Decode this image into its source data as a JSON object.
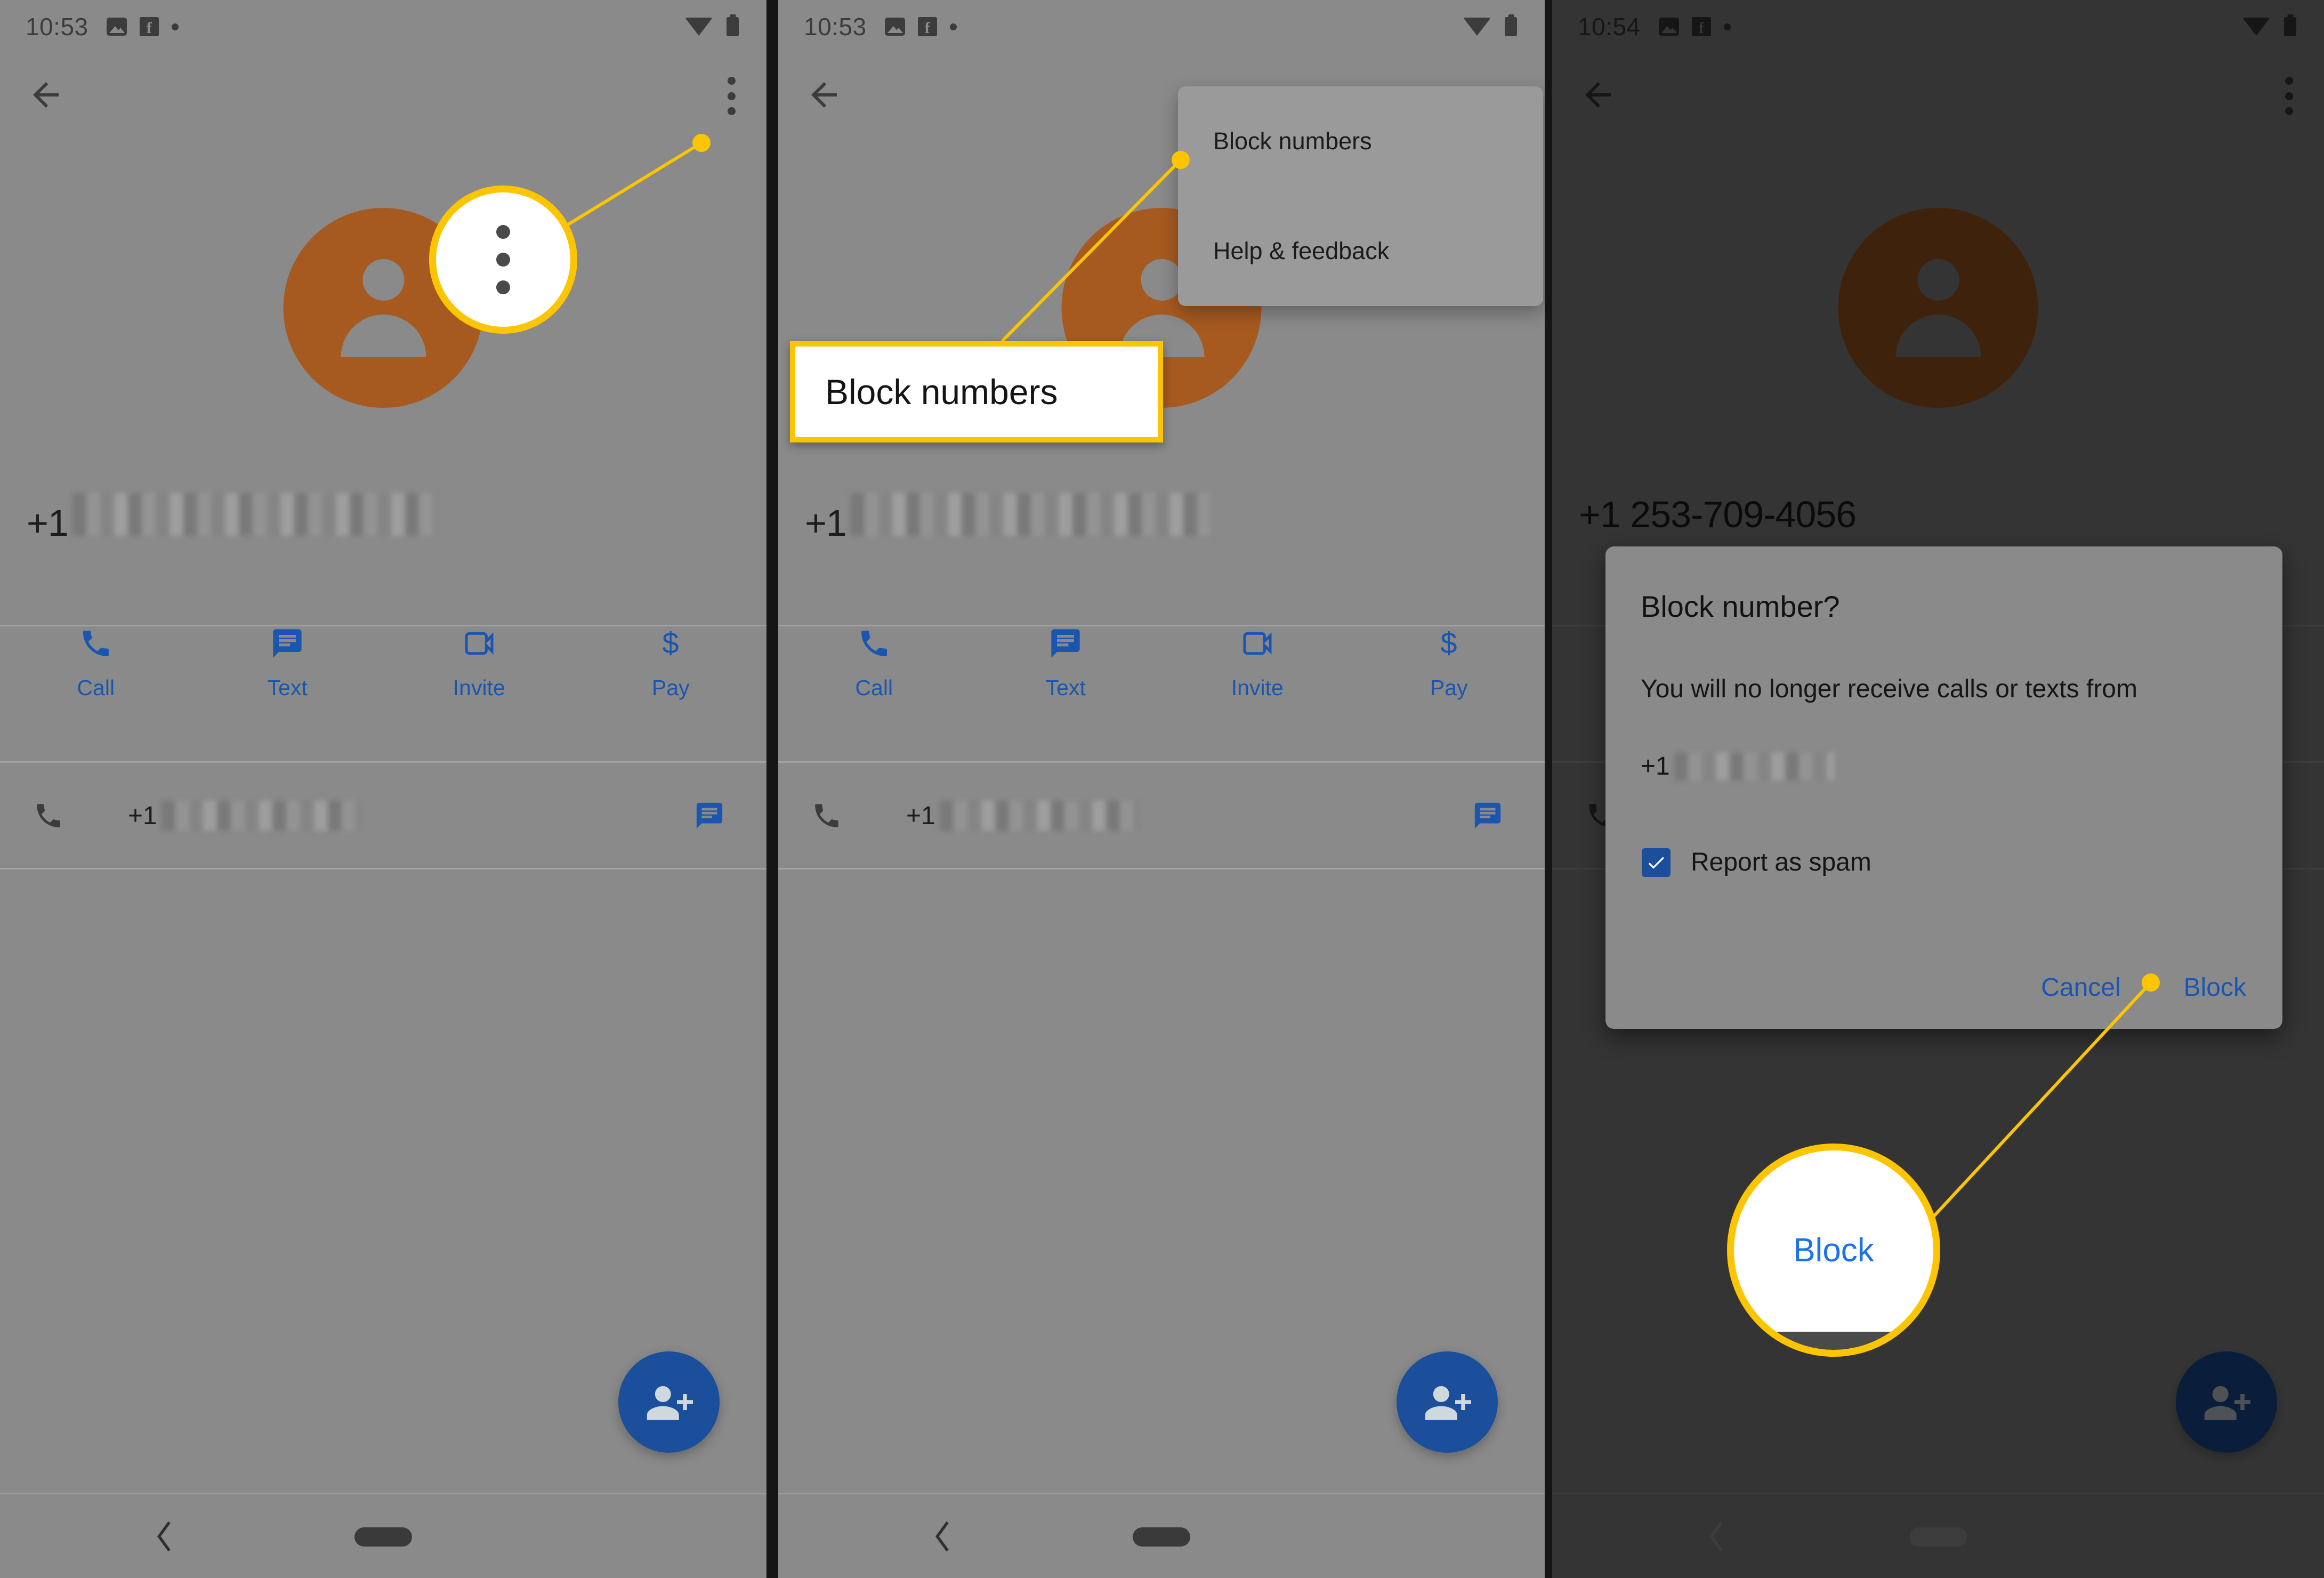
{
  "panels": [
    {
      "status": {
        "time": "10:53",
        "icons": [
          "photo-icon",
          "facebook-icon",
          "dot-icon",
          "wifi-icon",
          "battery-icon"
        ]
      },
      "appbar": {
        "back": "back-arrow-icon",
        "overflow": "overflow-menu-icon"
      },
      "contact": {
        "avatar": "person-avatar-icon",
        "number_prefix": "+1",
        "number_masked": true
      },
      "actions": [
        {
          "label": "Call",
          "icon": "phone-icon"
        },
        {
          "label": "Text",
          "icon": "message-icon"
        },
        {
          "label": "Invite",
          "icon": "video-call-icon"
        },
        {
          "label": "Pay",
          "icon": "dollar-icon"
        }
      ],
      "number_row": {
        "icon": "phone-icon",
        "prefix": "+1",
        "masked": true,
        "trailing_icon": "message-icon"
      },
      "fab": {
        "icon": "add-person-icon"
      },
      "nav": {
        "back": "nav-back-icon",
        "home": "nav-home-pill"
      }
    },
    {
      "status": {
        "time": "10:53"
      },
      "menu": {
        "items": [
          "Block numbers",
          "Help & feedback"
        ]
      },
      "contact": {
        "number_prefix": "+1",
        "number_masked": true
      },
      "actions": [
        {
          "label": "Call",
          "icon": "phone-icon"
        },
        {
          "label": "Text",
          "icon": "message-icon"
        },
        {
          "label": "Invite",
          "icon": "video-call-icon"
        },
        {
          "label": "Pay",
          "icon": "dollar-icon"
        }
      ],
      "number_row": {
        "prefix": "+1",
        "masked": true
      }
    },
    {
      "status": {
        "time": "10:54"
      },
      "contact": {
        "number": "+1 253-709-4056"
      },
      "dialog": {
        "title": "Block number?",
        "body": "You will no longer receive calls or texts from",
        "number_prefix": "+1",
        "number_masked": true,
        "checkbox": {
          "label": "Report as spam",
          "checked": true
        },
        "buttons": [
          "Cancel",
          "Block"
        ]
      }
    }
  ],
  "annotations": {
    "callout_1_label": "Block numbers",
    "callout_2_label": "Block",
    "accent_color": "#fdc500",
    "link_color": "#1a56b0",
    "avatar_color": "#a65a20",
    "fab_color": "#1b4f9c"
  }
}
